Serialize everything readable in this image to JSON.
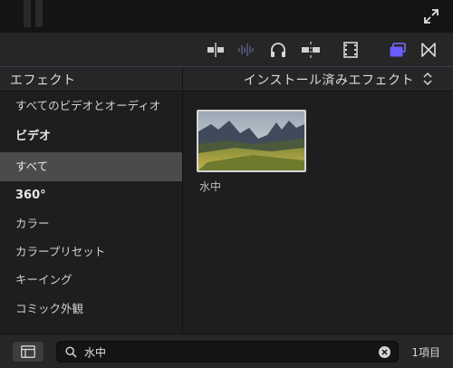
{
  "colors": {
    "accent": "#6b5cff",
    "selected_row": "#4b4b4b",
    "panel_bg": "#1e1e1e",
    "toolbar_bg": "#262626"
  },
  "toolbar": {
    "icons": [
      "audio-video-split-icon",
      "audio-waveform-icon",
      "headphones-icon",
      "snapping-icon",
      "film-strip-icon",
      "effects-browser-icon",
      "transitions-browser-icon"
    ]
  },
  "header": {
    "left_title": "エフェクト",
    "right_title": "インストール済みエフェクト"
  },
  "sidebar": {
    "items": [
      {
        "label": "すべてのビデオとオーディオ",
        "style": "normal"
      },
      {
        "label": "ビデオ",
        "style": "bold"
      },
      {
        "label": "すべて",
        "style": "selected"
      },
      {
        "label": "360°",
        "style": "bold"
      },
      {
        "label": "カラー",
        "style": "normal"
      },
      {
        "label": "カラープリセット",
        "style": "normal"
      },
      {
        "label": "キーイング",
        "style": "normal"
      },
      {
        "label": "コミック外観",
        "style": "normal"
      }
    ]
  },
  "grid": {
    "items": [
      {
        "label": "水中"
      }
    ]
  },
  "bottom": {
    "search_value": "水中",
    "count": "1項目"
  }
}
